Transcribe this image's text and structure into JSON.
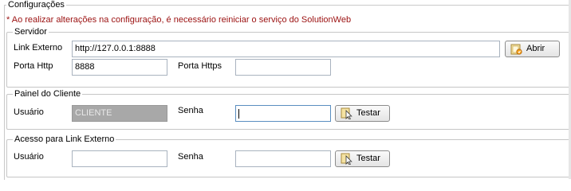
{
  "config": {
    "title": "Configurações",
    "warning": "* Ao realizar alterações na configuração, é necessário reiniciar o serviço do SolutionWeb"
  },
  "servidor": {
    "title": "Servidor",
    "link_label": "Link Externo",
    "link_value": "http://127.0.0.1:8888",
    "open_button": "Abrir",
    "http_label": "Porta Http",
    "http_value": "8888",
    "https_label": "Porta Https",
    "https_value": ""
  },
  "painel": {
    "title": "Painel do Cliente",
    "user_label": "Usuário",
    "user_value": "CLIENTE",
    "pass_label": "Senha",
    "pass_value": "",
    "test_button": "Testar"
  },
  "acesso": {
    "title": "Acesso para Link Externo",
    "user_label": "Usuário",
    "user_value": "",
    "pass_label": "Senha",
    "pass_value": "",
    "test_button": "Testar"
  },
  "icons": {
    "open": "folder-open-icon",
    "test": "test-pointer-icon"
  }
}
